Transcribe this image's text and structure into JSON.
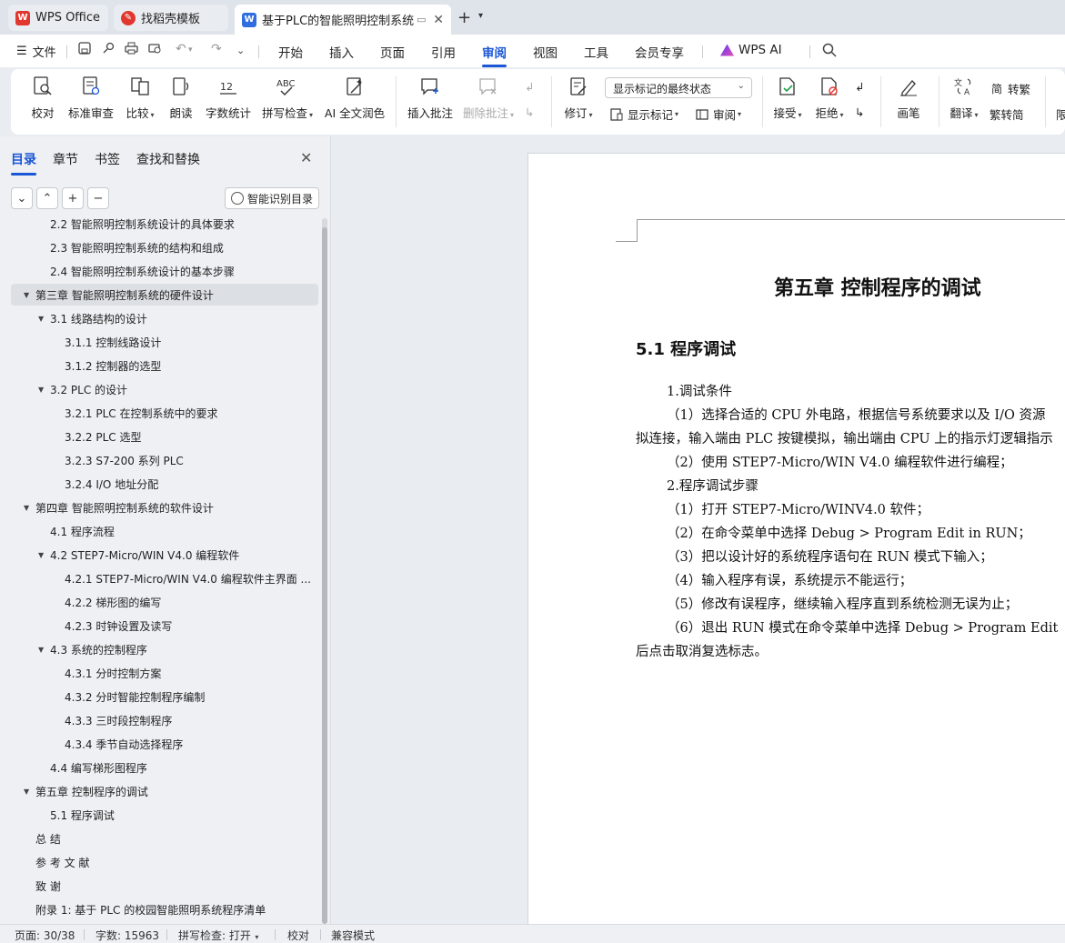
{
  "tabs": {
    "wps": "WPS Office",
    "template": "找稻壳模板",
    "doc": "基于PLC的智能照明控制系统"
  },
  "menu": {
    "file": "文件",
    "items": [
      "开始",
      "插入",
      "页面",
      "引用",
      "审阅",
      "视图",
      "工具",
      "会员专享"
    ],
    "active": "审阅",
    "ai": "WPS AI"
  },
  "ribbon": {
    "proofread": "校对",
    "standard_review": "标准审查",
    "compare": "比较",
    "read_aloud": "朗读",
    "word_count": "字数统计",
    "spell_check": "拼写检查",
    "ai_polish": "AI 全文润色",
    "insert_comment": "插入批注",
    "delete_comment": "删除批注",
    "track_changes": "修订",
    "markup_state": "显示标记的最终状态",
    "show_markup": "显示标记",
    "review_pane": "审阅",
    "accept": "接受",
    "reject": "拒绝",
    "pen": "画笔",
    "translate": "翻译",
    "to_traditional": "转繁",
    "to_simplified": "繁转简",
    "limit": "限"
  },
  "nav": {
    "tabs": [
      "目录",
      "章节",
      "书签",
      "查找和替换"
    ],
    "smart_toc": "智能识别目录",
    "toc": [
      {
        "text": "2.2  智能照明控制系统设计的具体要求",
        "level": 2,
        "arrow": ""
      },
      {
        "text": "2.3  智能照明控制系统的结构和组成",
        "level": 2,
        "arrow": ""
      },
      {
        "text": "2.4  智能照明控制系统设计的基本步骤",
        "level": 2,
        "arrow": ""
      },
      {
        "text": "第三章  智能照明控制系统的硬件设计",
        "level": 1,
        "arrow": "▼",
        "selected": true
      },
      {
        "text": "3.1 线路结构的设计",
        "level": 2,
        "arrow": "▼"
      },
      {
        "text": "3.1.1  控制线路设计",
        "level": 3,
        "arrow": ""
      },
      {
        "text": "3.1.2  控制器的选型",
        "level": 3,
        "arrow": ""
      },
      {
        "text": "3.2 PLC 的设计",
        "level": 2,
        "arrow": "▼"
      },
      {
        "text": "3.2.1 PLC 在控制系统中的要求",
        "level": 3,
        "arrow": ""
      },
      {
        "text": "3.2.2 PLC 选型",
        "level": 3,
        "arrow": ""
      },
      {
        "text": "3.2.3 S7-200 系列 PLC",
        "level": 3,
        "arrow": ""
      },
      {
        "text": "3.2.4 I/O 地址分配",
        "level": 3,
        "arrow": ""
      },
      {
        "text": "第四章  智能照明控制系统的软件设计",
        "level": 1,
        "arrow": "▼"
      },
      {
        "text": "4.1  程序流程",
        "level": 2,
        "arrow": ""
      },
      {
        "text": "4.2 STEP7-Micro/WIN V4.0 编程软件",
        "level": 2,
        "arrow": "▼"
      },
      {
        "text": "4.2.1 STEP7-Micro/WIN V4.0 编程软件主界面 ...",
        "level": 3,
        "arrow": ""
      },
      {
        "text": "4.2.2  梯形图的编写",
        "level": 3,
        "arrow": ""
      },
      {
        "text": "4.2.3  时钟设置及读写",
        "level": 3,
        "arrow": ""
      },
      {
        "text": "4.3  系统的控制程序",
        "level": 2,
        "arrow": "▼"
      },
      {
        "text": "4.3.1  分时控制方案",
        "level": 3,
        "arrow": ""
      },
      {
        "text": "4.3.2  分时智能控制程序编制",
        "level": 3,
        "arrow": ""
      },
      {
        "text": "4.3.3  三时段控制程序",
        "level": 3,
        "arrow": ""
      },
      {
        "text": "4.3.4  季节自动选择程序",
        "level": 3,
        "arrow": ""
      },
      {
        "text": "4.4  编写梯形图程序",
        "level": 2,
        "arrow": ""
      },
      {
        "text": "第五章  控制程序的调试",
        "level": 1,
        "arrow": "▼"
      },
      {
        "text": "5.1  程序调试",
        "level": 2,
        "arrow": ""
      },
      {
        "text": "总   结",
        "level": 1,
        "arrow": ""
      },
      {
        "text": "参 考 文 献",
        "level": 1,
        "arrow": ""
      },
      {
        "text": "致   谢",
        "level": 1,
        "arrow": ""
      },
      {
        "text": "附录 1:  基于 PLC 的校园智能照明系统程序清单",
        "level": 1,
        "arrow": ""
      }
    ]
  },
  "document": {
    "chapter_title": "第五章  控制程序的调试",
    "section_title": "5.1  程序调试",
    "lines": [
      "1.调试条件",
      "（1）选择合适的 CPU 外电路，根据信号系统要求以及 I/O 资源",
      "拟连接，输入端由 PLC 按键模拟，输出端由 CPU 上的指示灯逻辑指示",
      "（2）使用 STEP7-Micro/WIN V4.0 编程软件进行编程；",
      "2.程序调试步骤",
      "（1）打开 STEP7-Micro/WINV4.0 软件；",
      "（2）在命令菜单中选择 Debug > Program Edit in RUN；",
      "（3）把以设计好的系统程序语句在 RUN 模式下输入；",
      "（4）输入程序有误，系统提示不能运行；",
      "（5）修改有误程序，继续输入程序直到系统检测无误为止；",
      "（6）退出 RUN 模式在命令菜单中选择 Debug > Program Edit ",
      "后点击取消复选标志。"
    ]
  },
  "status": {
    "page": "页面: 30/38",
    "words": "字数: 15963",
    "spell": "拼写检查: 打开",
    "proof": "校对",
    "compat": "兼容模式"
  },
  "colors": {
    "accent": "#1a56d6",
    "wps_red": "#e2372f",
    "doc_blue": "#2f6de1"
  }
}
